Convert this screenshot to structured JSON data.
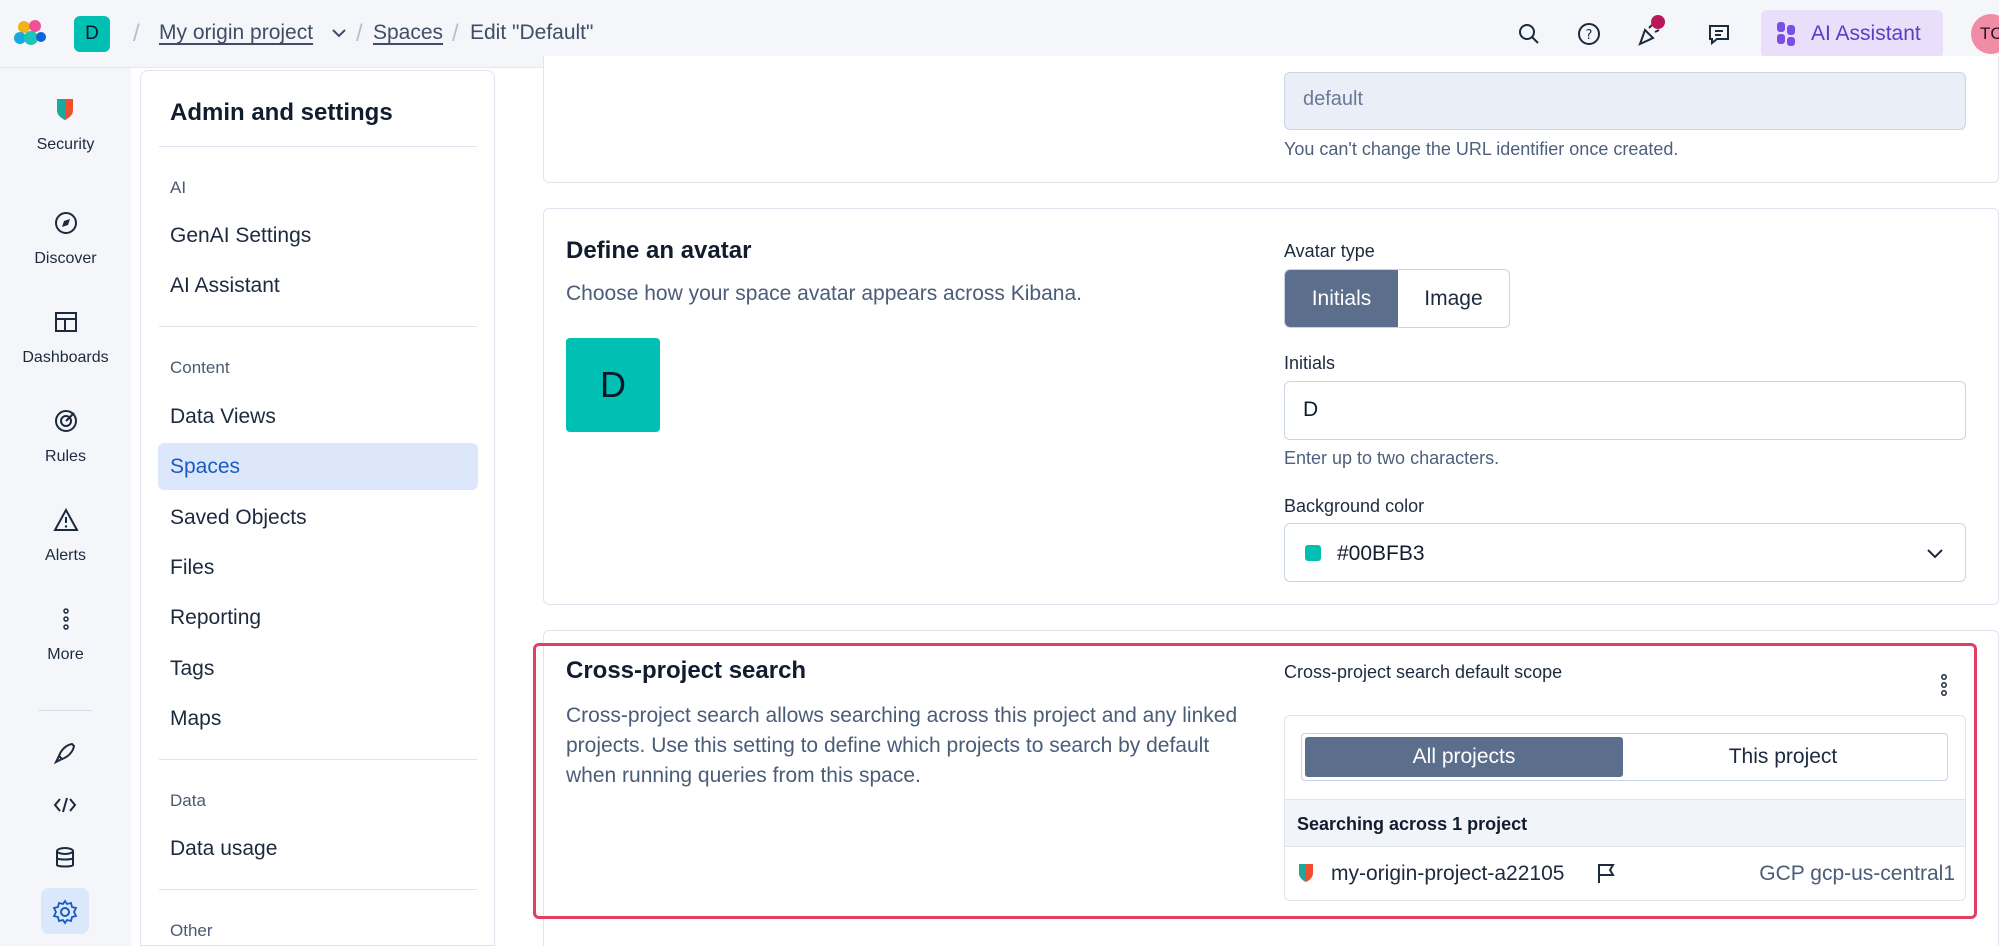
{
  "topbar": {
    "space_initial": "D",
    "breadcrumbs": [
      "My origin project",
      "Spaces",
      "Edit \"Default\""
    ],
    "ai_button": "AI Assistant",
    "user_initials": "TC"
  },
  "leftnav": {
    "items": [
      {
        "label": "Security",
        "icon": "security-icon"
      },
      {
        "label": "Discover",
        "icon": "compass-icon"
      },
      {
        "label": "Dashboards",
        "icon": "dashboard-icon"
      },
      {
        "label": "Rules",
        "icon": "rules-icon"
      },
      {
        "label": "Alerts",
        "icon": "warning-icon"
      },
      {
        "label": "More",
        "icon": "more-icon"
      }
    ],
    "tools": [
      "rocket-icon",
      "code-icon",
      "database-icon",
      "gear-icon"
    ]
  },
  "sidebar": {
    "title": "Admin and settings",
    "groups": [
      {
        "title": "AI",
        "items": [
          "GenAI Settings",
          "AI Assistant"
        ]
      },
      {
        "title": "Content",
        "items": [
          "Data Views",
          "Spaces",
          "Saved Objects",
          "Files",
          "Reporting",
          "Tags",
          "Maps"
        ]
      },
      {
        "title": "Data",
        "items": [
          "Data usage"
        ]
      },
      {
        "title": "Other",
        "items": []
      }
    ],
    "active_item": "Spaces"
  },
  "url_section": {
    "value": "default",
    "help": "You can't change the URL identifier once created."
  },
  "avatar_section": {
    "title": "Define an avatar",
    "description": "Choose how your space avatar appears across Kibana.",
    "preview": "D",
    "avatar_type_label": "Avatar type",
    "type_options": [
      "Initials",
      "Image"
    ],
    "selected_type": "Initials",
    "initials_label": "Initials",
    "initials_value": "D",
    "initials_help": "Enter up to two characters.",
    "bg_label": "Background color",
    "bg_value": "#00BFB3",
    "bg_color": "#00BFB3"
  },
  "cps_section": {
    "title": "Cross-project search",
    "description": "Cross-project search allows searching across this project and any linked projects. Use this setting to define which projects to search by default when running queries from this space.",
    "scope_label": "Cross-project search default scope",
    "scope_options": [
      "All projects",
      "This project"
    ],
    "selected_scope": "All projects",
    "searching_text": "Searching across 1 project",
    "project_name": "my-origin-project-a22105",
    "project_region": "GCP gcp-us-central1"
  }
}
